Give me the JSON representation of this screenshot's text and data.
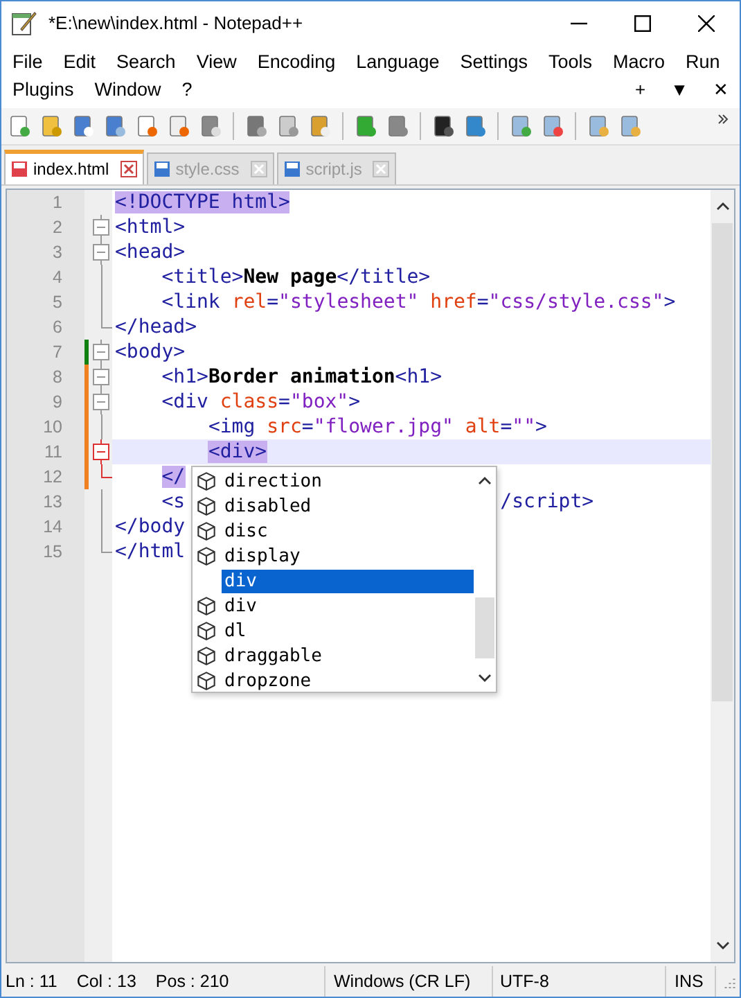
{
  "window": {
    "title": "*E:\\new\\index.html - Notepad++"
  },
  "menu_rows": [
    [
      "File",
      "Edit",
      "Search",
      "View",
      "Encoding",
      "Language",
      "Settings",
      "Tools",
      "Macro",
      "Run"
    ],
    [
      "Plugins",
      "Window",
      "?"
    ]
  ],
  "menu_extras": [
    "+",
    "▼",
    "✕"
  ],
  "tabs": [
    {
      "label": "index.html",
      "selected": true,
      "modified": true
    },
    {
      "label": "style.css",
      "selected": false,
      "modified": false
    },
    {
      "label": "script.js",
      "selected": false,
      "modified": false
    }
  ],
  "lines": [
    {
      "number": "1",
      "kind": "none",
      "saved": false,
      "modified": false,
      "current": false,
      "tokens": [
        {
          "t": "<!DOCTYPE html>",
          "kind": "tag",
          "hl": true
        }
      ]
    },
    {
      "number": "2",
      "kind": "box",
      "saved": false,
      "modified": false,
      "current": false,
      "tokens": [
        {
          "t": "<html>",
          "kind": "tag",
          "hl": false
        }
      ]
    },
    {
      "number": "3",
      "kind": "box",
      "saved": false,
      "modified": false,
      "current": false,
      "tokens": [
        {
          "t": "<head>",
          "kind": "tag",
          "hl": false
        }
      ]
    },
    {
      "number": "4",
      "kind": "line",
      "saved": false,
      "modified": false,
      "current": false,
      "tokens": [
        {
          "t": "    <title>",
          "kind": "tag",
          "hl": false
        },
        {
          "t": "New page",
          "kind": "text",
          "hl": false
        },
        {
          "t": "</title>",
          "kind": "tag",
          "hl": false
        }
      ]
    },
    {
      "number": "5",
      "kind": "line",
      "saved": false,
      "modified": false,
      "current": false,
      "tokens": [
        {
          "t": "    <link",
          "kind": "tag",
          "hl": false
        },
        {
          "t": " rel",
          "kind": "attr",
          "hl": false
        },
        {
          "t": "=",
          "kind": "tag",
          "hl": false
        },
        {
          "t": "\"stylesheet\"",
          "kind": "str",
          "hl": false
        },
        {
          "t": " href",
          "kind": "attr",
          "hl": false
        },
        {
          "t": "=",
          "kind": "tag",
          "hl": false
        },
        {
          "t": "\"css/style.css\"",
          "kind": "str",
          "hl": false
        },
        {
          "t": ">",
          "kind": "tag",
          "hl": false
        }
      ]
    },
    {
      "number": "6",
      "kind": "end",
      "saved": false,
      "modified": false,
      "current": false,
      "tokens": [
        {
          "t": "</head>",
          "kind": "tag",
          "hl": false
        }
      ]
    },
    {
      "number": "7",
      "kind": "box",
      "saved": true,
      "modified": false,
      "current": false,
      "tokens": [
        {
          "t": "<body>",
          "kind": "tag",
          "hl": false
        }
      ]
    },
    {
      "number": "8",
      "kind": "box",
      "saved": false,
      "modified": true,
      "current": false,
      "tokens": [
        {
          "t": "    <h1>",
          "kind": "tag",
          "hl": false
        },
        {
          "t": "Border animation",
          "kind": "text",
          "hl": false
        },
        {
          "t": "<h1>",
          "kind": "tag",
          "hl": false
        }
      ]
    },
    {
      "number": "9",
      "kind": "box",
      "saved": false,
      "modified": true,
      "current": false,
      "tokens": [
        {
          "t": "    <div",
          "kind": "tag",
          "hl": false
        },
        {
          "t": " class",
          "kind": "attr",
          "hl": false
        },
        {
          "t": "=",
          "kind": "tag",
          "hl": false
        },
        {
          "t": "\"box\"",
          "kind": "str",
          "hl": false
        },
        {
          "t": ">",
          "kind": "tag",
          "hl": false
        }
      ]
    },
    {
      "number": "10",
      "kind": "line",
      "saved": false,
      "modified": true,
      "current": false,
      "tokens": [
        {
          "t": "        <img",
          "kind": "tag",
          "hl": false
        },
        {
          "t": " src",
          "kind": "attr",
          "hl": false
        },
        {
          "t": "=",
          "kind": "tag",
          "hl": false
        },
        {
          "t": "\"flower.jpg\"",
          "kind": "str",
          "hl": false
        },
        {
          "t": " alt",
          "kind": "attr",
          "hl": false
        },
        {
          "t": "=",
          "kind": "tag",
          "hl": false
        },
        {
          "t": "\"\"",
          "kind": "str",
          "hl": false
        },
        {
          "t": ">",
          "kind": "tag",
          "hl": false
        }
      ]
    },
    {
      "number": "11",
      "kind": "box",
      "saved": false,
      "modified": true,
      "current": true,
      "fold_active": true,
      "tokens": [
        {
          "t": "        <div>",
          "kind": "tag",
          "hl": true
        }
      ]
    },
    {
      "number": "12",
      "kind": "end",
      "saved": false,
      "modified": true,
      "current": false,
      "fold_active": true,
      "tokens": [
        {
          "t": "    </",
          "kind": "tag",
          "hl": true
        }
      ]
    },
    {
      "number": "13",
      "kind": "line",
      "saved": false,
      "modified": false,
      "current": false,
      "tokens": [
        {
          "t": "    <s",
          "kind": "tag",
          "hl": false
        },
        {
          "t": "                           /script>",
          "kind": "tag",
          "hl": false
        }
      ]
    },
    {
      "number": "14",
      "kind": "line",
      "saved": false,
      "modified": false,
      "current": false,
      "tokens": [
        {
          "t": "</body",
          "kind": "tag",
          "hl": false
        }
      ]
    },
    {
      "number": "15",
      "kind": "end",
      "saved": false,
      "modified": false,
      "current": false,
      "tokens": [
        {
          "t": "</html",
          "kind": "tag",
          "hl": false
        }
      ]
    }
  ],
  "autocomplete": [
    {
      "text": "direction",
      "icon": true,
      "selected": false
    },
    {
      "text": "disabled",
      "icon": true,
      "selected": false
    },
    {
      "text": "disc",
      "icon": true,
      "selected": false
    },
    {
      "text": "display",
      "icon": true,
      "selected": false
    },
    {
      "text": "div",
      "icon": false,
      "selected": true
    },
    {
      "text": "div",
      "icon": true,
      "selected": false
    },
    {
      "text": "dl",
      "icon": true,
      "selected": false
    },
    {
      "text": "draggable",
      "icon": true,
      "selected": false
    },
    {
      "text": "dropzone",
      "icon": true,
      "selected": false
    }
  ],
  "status_bar": {
    "position": [
      "Ln : 11",
      "Col : 13",
      "Pos : 210"
    ],
    "line_ending": "Windows (CR LF)",
    "encoding": "UTF-8",
    "mode": "INS"
  }
}
